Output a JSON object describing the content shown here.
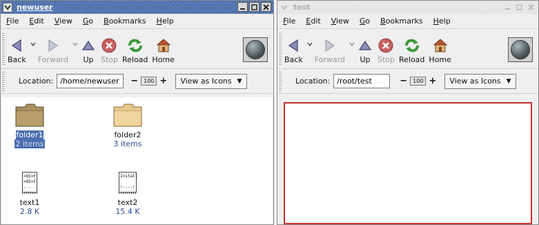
{
  "windows": [
    {
      "title": "newuser",
      "menu": [
        {
          "u": "F",
          "rest": "ile"
        },
        {
          "u": "E",
          "rest": "dit"
        },
        {
          "u": "V",
          "rest": "iew"
        },
        {
          "u": "G",
          "rest": "o"
        },
        {
          "u": "B",
          "rest": "ookmarks"
        },
        {
          "u": "H",
          "rest": "elp"
        }
      ],
      "toolbar": {
        "back": "Back",
        "forward": "Forward",
        "up": "Up",
        "stop": "Stop",
        "reload": "Reload",
        "home": "Home"
      },
      "location": {
        "label": "Location:",
        "value": "/home/newuser",
        "zoom": "100",
        "view_as": "View as Icons"
      },
      "files": [
        {
          "name": "folder1",
          "info": "2 items",
          "kind": "folder",
          "selected": true
        },
        {
          "name": "folder2",
          "info": "3 items",
          "kind": "folder",
          "selected": false
        },
        {
          "name": "text1",
          "info": "2.8 K",
          "kind": "text",
          "preview": [
            "<85>F",
            "<85>F",
            "-  -"
          ]
        },
        {
          "name": "text2",
          "info": "15.4 K",
          "kind": "text",
          "preview": [
            "Install",
            "",
            "!----!"
          ]
        }
      ]
    },
    {
      "title": "test",
      "menu": [
        {
          "u": "F",
          "rest": "ile"
        },
        {
          "u": "E",
          "rest": "dit"
        },
        {
          "u": "V",
          "rest": "iew"
        },
        {
          "u": "G",
          "rest": "o"
        },
        {
          "u": "B",
          "rest": "ookmarks"
        },
        {
          "u": "H",
          "rest": "elp"
        }
      ],
      "toolbar": {
        "back": "Back",
        "forward": "Forward",
        "up": "Up",
        "stop": "Stop",
        "reload": "Reload",
        "home": "Home"
      },
      "location": {
        "label": "Location:",
        "value": "/root/test",
        "zoom": "100",
        "view_as": "View as Icons"
      },
      "files": []
    }
  ],
  "colors": {
    "active_title": "#5074b0",
    "selection": "#4a6fb0",
    "drop_border": "#c43030"
  }
}
